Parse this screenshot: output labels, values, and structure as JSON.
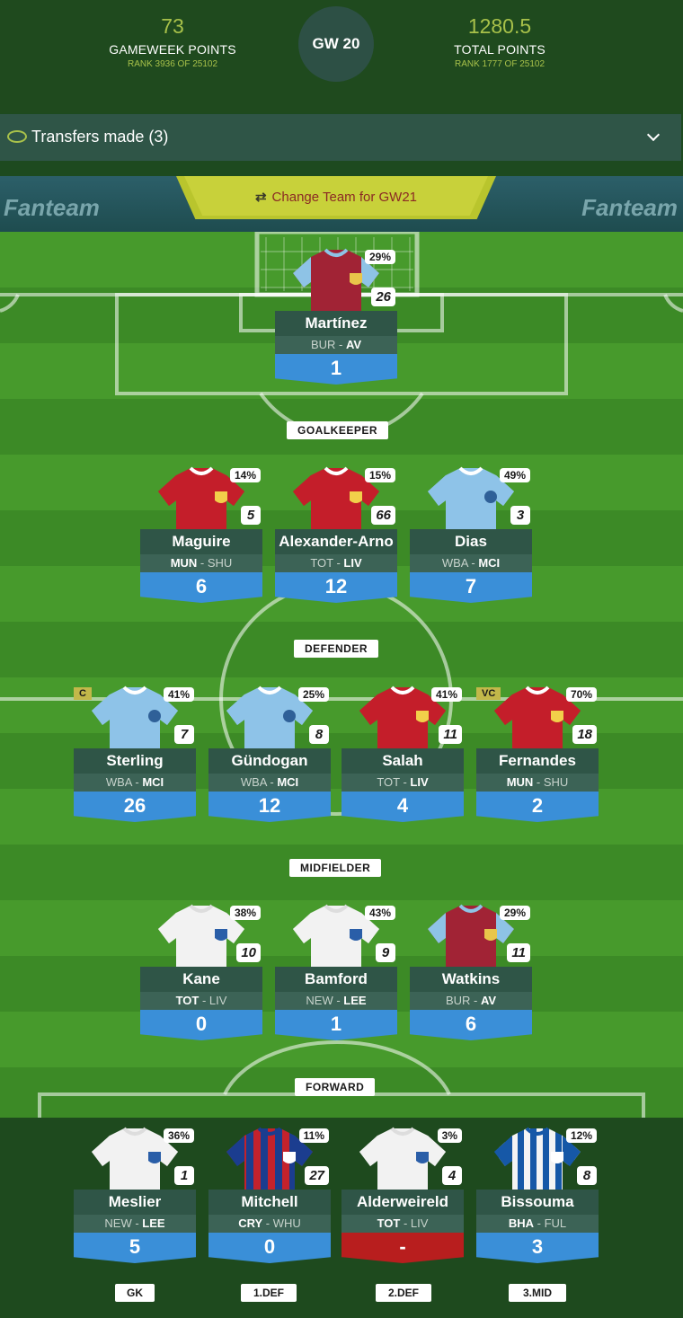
{
  "header": {
    "gameweek_points": "73",
    "gameweek_points_label": "GAMEWEEK POINTS",
    "gameweek_rank": "RANK 3936 OF 25102",
    "gw_badge": "GW 20",
    "total_points": "1280.5",
    "total_points_label": "TOTAL POINTS",
    "total_rank": "RANK 1777 OF 25102"
  },
  "transfers": {
    "label": "Transfers made (3)",
    "icon": "transfer-loop-icon",
    "toggle_icon": "chevron-down-icon"
  },
  "pitch": {
    "brand_left": "Fanteam",
    "brand_right": "Fanteam",
    "change_team": "Change Team for GW21",
    "change_icon": "swap-arrows-icon"
  },
  "positions": {
    "goalkeeper": "GOALKEEPER",
    "defender": "DEFENDER",
    "midfielder": "MIDFIELDER",
    "forward": "FORWARD"
  },
  "colors": {
    "accent_green": "#a8c14a",
    "card_dark": "#2f5547",
    "score_blue": "#3a8fd8",
    "score_red": "#b81e1e"
  },
  "players": [
    {
      "id": "martinez",
      "name": "Martínez",
      "home": "BUR",
      "away": "AV",
      "bold": "away",
      "pct": "29%",
      "own": "26",
      "score": "1",
      "kit": "villa",
      "cap": ""
    },
    {
      "id": "maguire",
      "name": "Maguire",
      "home": "MUN",
      "away": "SHU",
      "bold": "home",
      "pct": "14%",
      "own": "5",
      "score": "6",
      "kit": "red",
      "cap": ""
    },
    {
      "id": "alexander-arno",
      "name": "Alexander-Arno",
      "home": "TOT",
      "away": "LIV",
      "bold": "away",
      "pct": "15%",
      "own": "66",
      "score": "12",
      "kit": "red",
      "cap": ""
    },
    {
      "id": "dias",
      "name": "Dias",
      "home": "WBA",
      "away": "MCI",
      "bold": "away",
      "pct": "49%",
      "own": "3",
      "score": "7",
      "kit": "sky",
      "cap": ""
    },
    {
      "id": "sterling",
      "name": "Sterling",
      "home": "WBA",
      "away": "MCI",
      "bold": "away",
      "pct": "41%",
      "own": "7",
      "score": "26",
      "kit": "sky",
      "cap": "C"
    },
    {
      "id": "gundogan",
      "name": "Gündogan",
      "home": "WBA",
      "away": "MCI",
      "bold": "away",
      "pct": "25%",
      "own": "8",
      "score": "12",
      "kit": "sky",
      "cap": ""
    },
    {
      "id": "salah",
      "name": "Salah",
      "home": "TOT",
      "away": "LIV",
      "bold": "away",
      "pct": "41%",
      "own": "11",
      "score": "4",
      "kit": "red",
      "cap": ""
    },
    {
      "id": "fernandes",
      "name": "Fernandes",
      "home": "MUN",
      "away": "SHU",
      "bold": "home",
      "pct": "70%",
      "own": "18",
      "score": "2",
      "kit": "red",
      "cap": "VC"
    },
    {
      "id": "kane",
      "name": "Kane",
      "home": "TOT",
      "away": "LIV",
      "bold": "home",
      "pct": "38%",
      "own": "10",
      "score": "0",
      "kit": "white",
      "cap": ""
    },
    {
      "id": "bamford",
      "name": "Bamford",
      "home": "NEW",
      "away": "LEE",
      "bold": "away",
      "pct": "43%",
      "own": "9",
      "score": "1",
      "kit": "white",
      "cap": ""
    },
    {
      "id": "watkins",
      "name": "Watkins",
      "home": "BUR",
      "away": "AV",
      "bold": "away",
      "pct": "29%",
      "own": "11",
      "score": "6",
      "kit": "villa",
      "cap": ""
    }
  ],
  "bench": [
    {
      "id": "meslier",
      "name": "Meslier",
      "home": "NEW",
      "away": "LEE",
      "bold": "away",
      "pct": "36%",
      "own": "1",
      "score": "5",
      "kit": "white",
      "label": "GK",
      "scoreColor": "blue"
    },
    {
      "id": "mitchell",
      "name": "Mitchell",
      "home": "CRY",
      "away": "WHU",
      "bold": "home",
      "pct": "11%",
      "own": "27",
      "score": "0",
      "kit": "stripes",
      "label": "1.DEF",
      "scoreColor": "blue"
    },
    {
      "id": "alderweireld",
      "name": "Alderweireld",
      "home": "TOT",
      "away": "LIV",
      "bold": "home",
      "pct": "3%",
      "own": "4",
      "score": "-",
      "kit": "white",
      "label": "2.DEF",
      "scoreColor": "red"
    },
    {
      "id": "bissouma",
      "name": "Bissouma",
      "home": "BHA",
      "away": "FUL",
      "bold": "home",
      "pct": "12%",
      "own": "8",
      "score": "3",
      "kit": "bhastripes",
      "label": "3.MID",
      "scoreColor": "blue"
    }
  ]
}
